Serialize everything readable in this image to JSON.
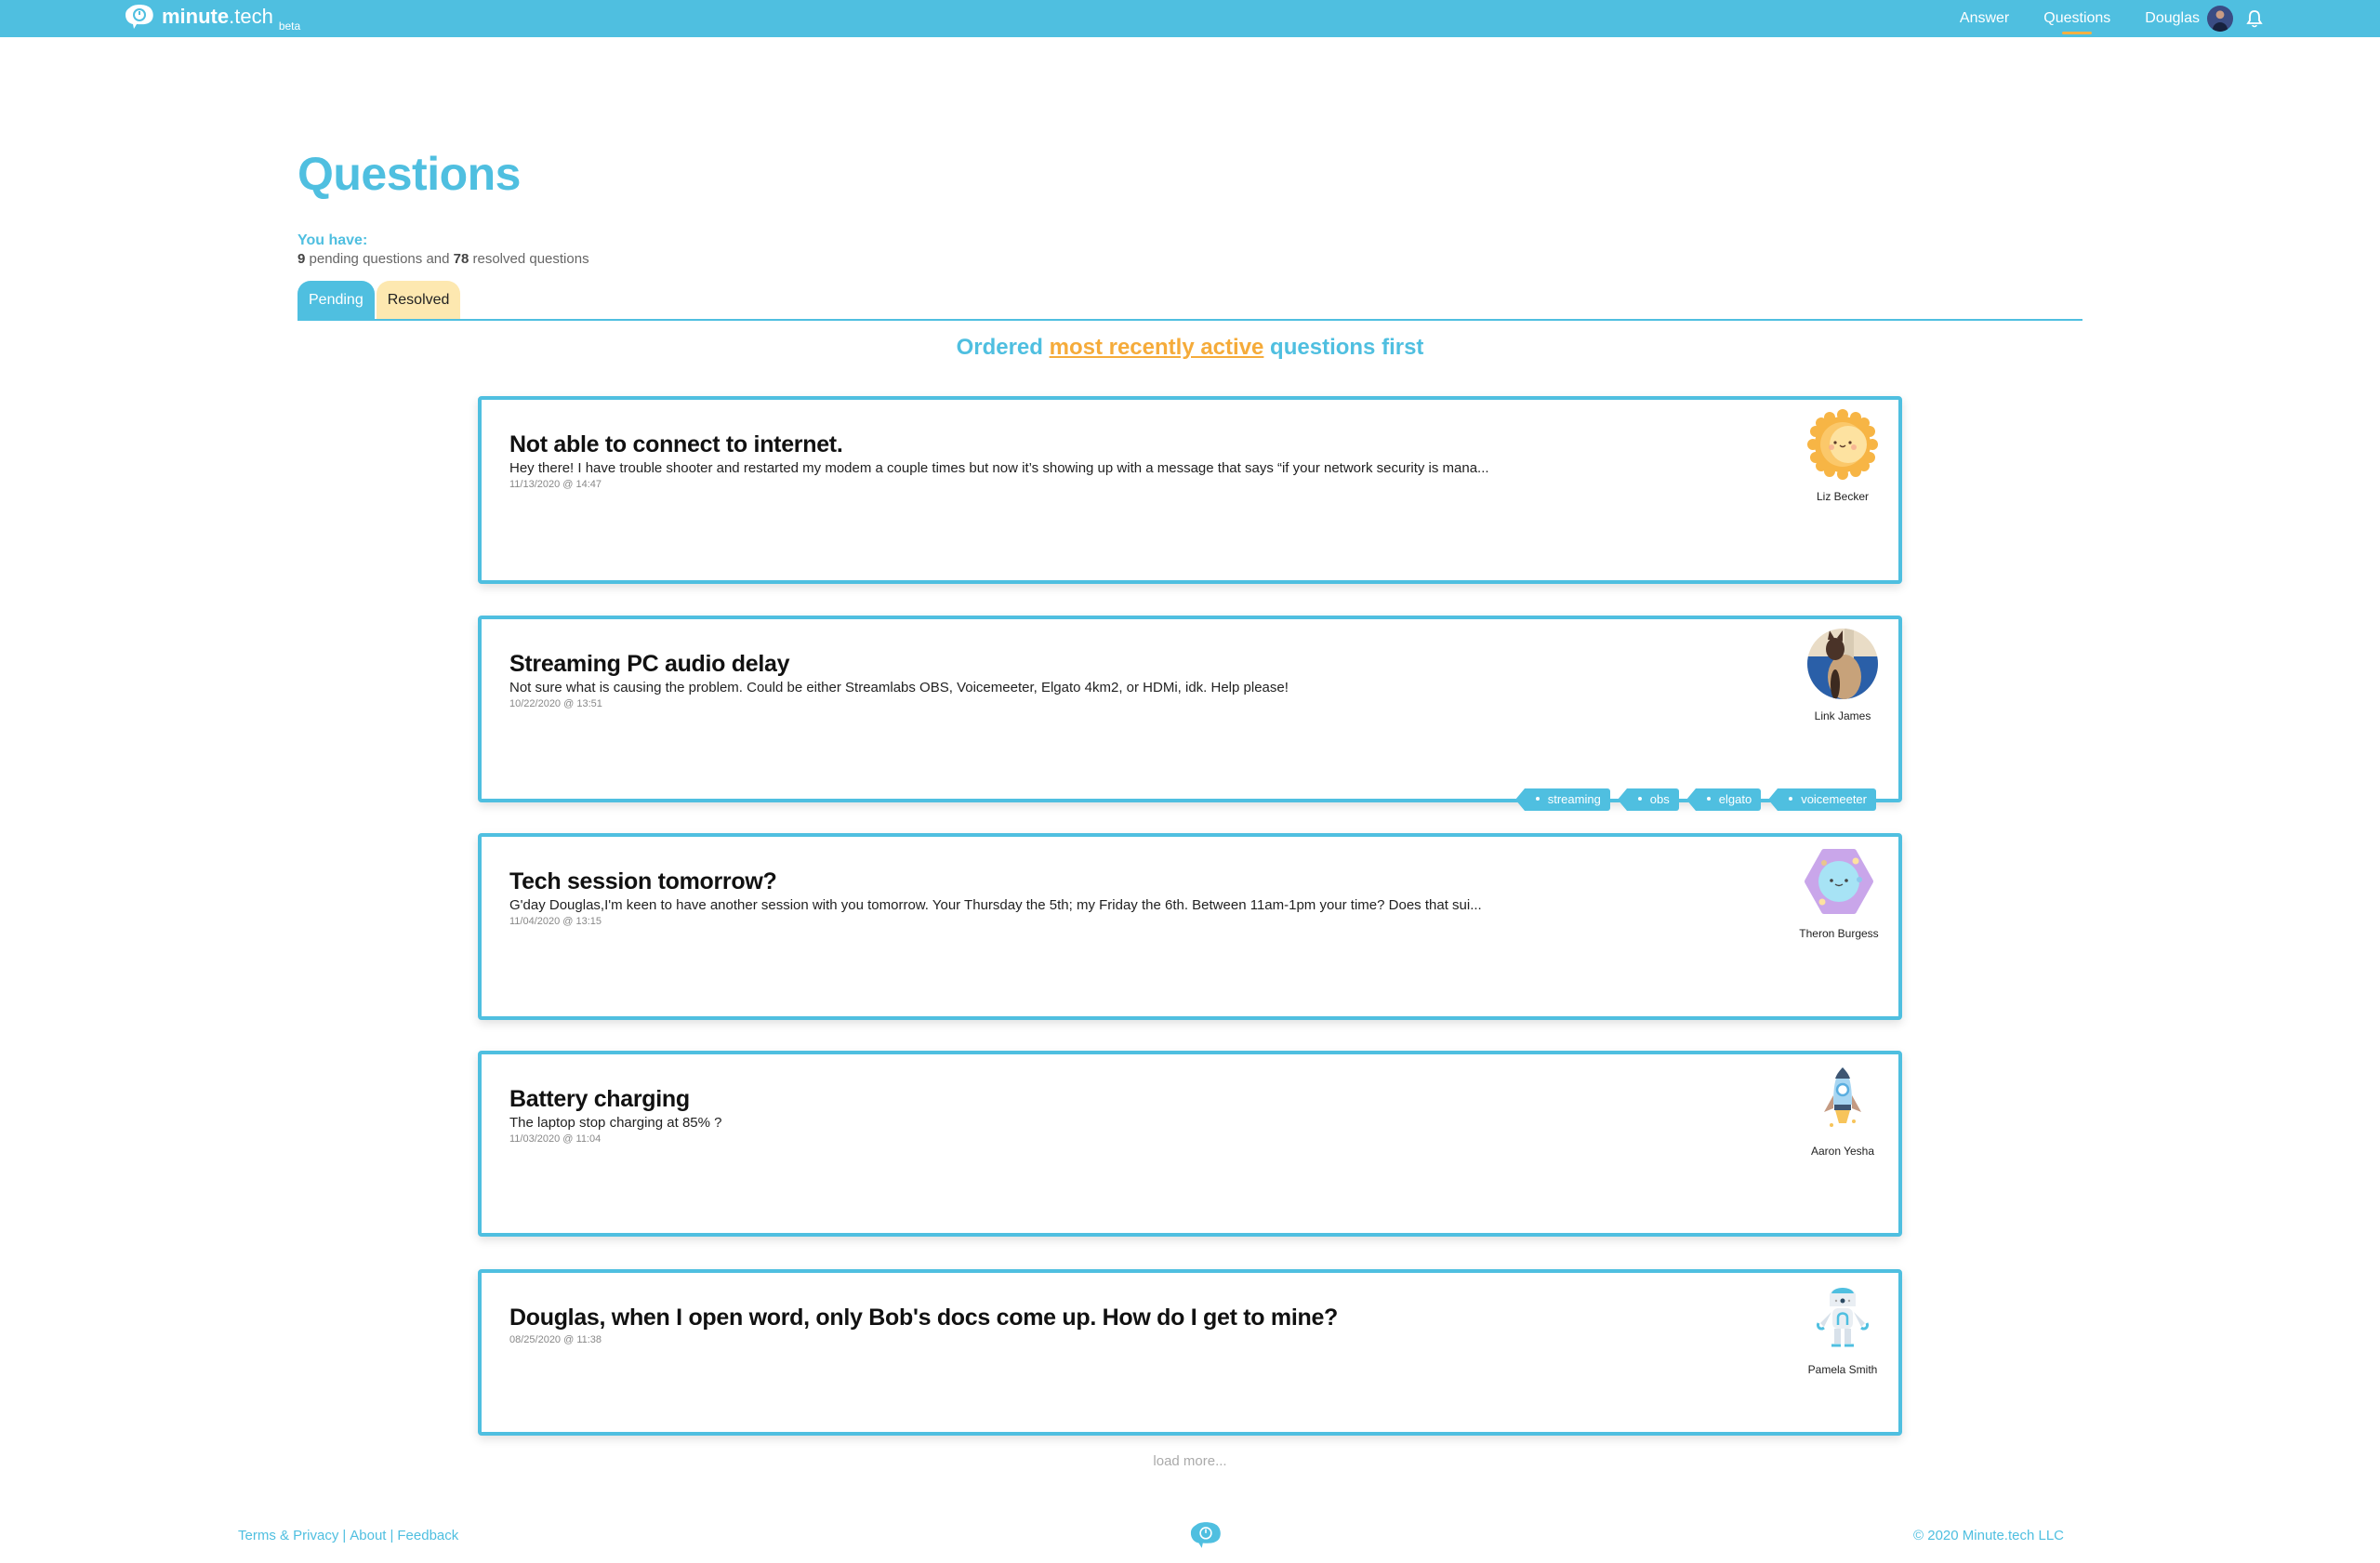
{
  "app": {
    "logo_bold": "minute",
    "logo_light": ".tech",
    "logo_badge": "beta"
  },
  "nav": {
    "answer": "Answer",
    "questions": "Questions",
    "user": "Douglas",
    "active": "Questions"
  },
  "page": {
    "title": "Questions",
    "you_have": "You have:",
    "pending_count": "9",
    "pending_label": " pending questions and ",
    "resolved_count": "78",
    "resolved_label": " resolved questions",
    "tabs": [
      {
        "label": "Pending",
        "active": true
      },
      {
        "label": "Resolved",
        "active": false
      }
    ],
    "order_prefix": "Ordered ",
    "order_highlight": "most recently active",
    "order_suffix": " questions first"
  },
  "questions": [
    {
      "title": "Not able to connect to internet.",
      "body": "Hey there! I have trouble shooter and restarted my modem a couple times but now it’s showing up with a message that says “if your network security is mana...",
      "date": "11/13/2020 @ 14:47",
      "asker": "Liz Becker",
      "avatar": "sun-avatar-icon",
      "tags": []
    },
    {
      "title": "Streaming PC audio delay",
      "body": "Not sure what is causing the problem. Could be either Streamlabs OBS, Voicemeeter, Elgato 4km2, or HDMi, idk. Help please!",
      "date": "10/22/2020 @ 13:51",
      "asker": "Link James",
      "avatar": "cat-photo-avatar",
      "tags": [
        "streaming",
        "obs",
        "elgato",
        "voicemeeter"
      ]
    },
    {
      "title": "Tech session tomorrow?",
      "body": "G'day Douglas,I'm keen to have another session with you tomorrow.  Your Thursday the 5th; my Friday the 6th.  Between 11am-1pm your time?  Does that sui...",
      "date": "11/04/2020 @ 13:15",
      "asker": "Theron Burgess",
      "avatar": "planet-avatar-icon",
      "tags": []
    },
    {
      "title": "Battery charging",
      "body": "The laptop stop  charging at 85% ?",
      "date": "11/03/2020 @ 11:04",
      "asker": "Aaron Yesha",
      "avatar": "rocket-avatar-icon",
      "tags": []
    },
    {
      "title": "Douglas, when I open word, only Bob's docs come up. How do I get to mine?",
      "body": "",
      "date": "08/25/2020 @ 11:38",
      "asker": "Pamela Smith",
      "avatar": "robot-avatar-icon",
      "tags": []
    }
  ],
  "load_more": "load more...",
  "footer": {
    "terms": "Terms & Privacy",
    "about": "About",
    "feedback": "Feedback",
    "separator": "|",
    "copyright": "© 2020 Minute.tech LLC"
  },
  "colors": {
    "brand": "#4fbfe0",
    "accent": "#f5ab3a",
    "resolved_tab": "#fde8b0"
  }
}
